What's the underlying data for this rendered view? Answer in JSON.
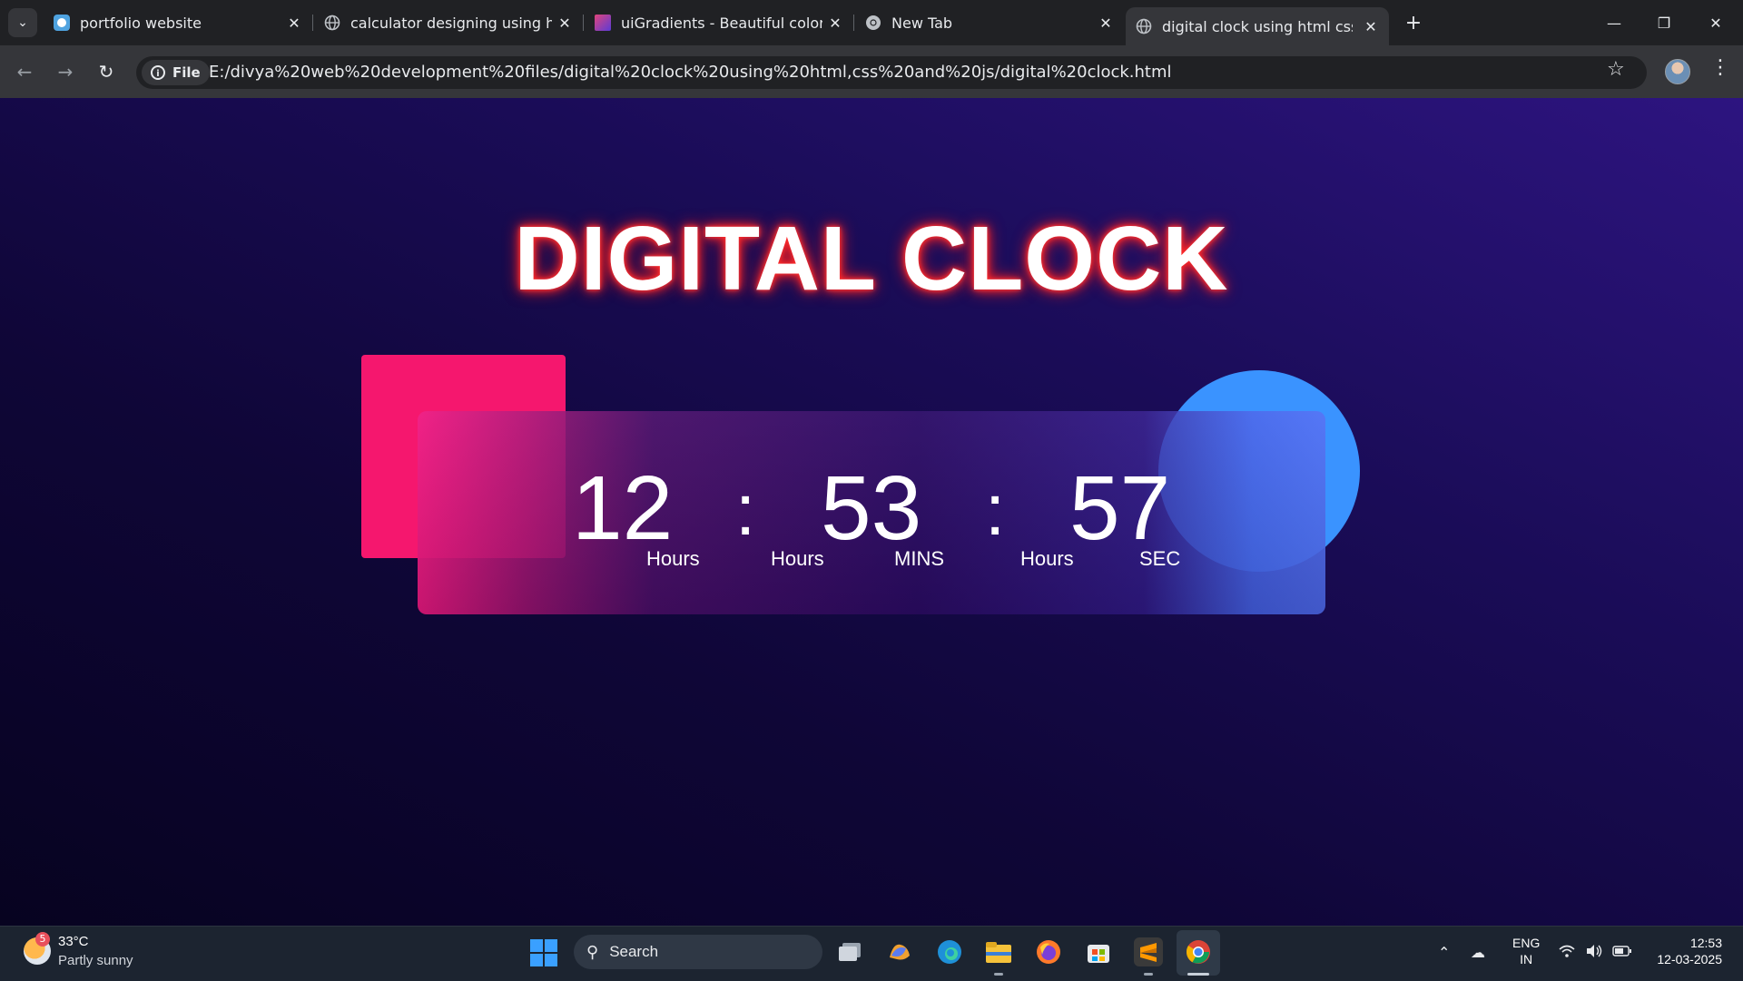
{
  "browser": {
    "tabs": [
      {
        "label": "portfolio website",
        "icon": "site-logo-icon"
      },
      {
        "label": "calculator designing using html",
        "icon": "globe-icon"
      },
      {
        "label": "uiGradients - Beautiful colored gradients",
        "icon": "uigradients-icon"
      },
      {
        "label": "New Tab",
        "icon": "chrome-icon"
      },
      {
        "label": "digital clock using html css and js",
        "icon": "globe-icon"
      }
    ],
    "active_tab_index": 4,
    "chip_label": "File",
    "url": "E:/divya%20web%20development%20files/digital%20clock%20using%20html,css%20and%20js/digital%20clock.html"
  },
  "page": {
    "title": "DIGITAL CLOCK",
    "clock": {
      "hours": "12",
      "minutes": "53",
      "seconds": "57",
      "separator": ":",
      "labels": [
        "Hours",
        "Hours",
        "MINS",
        "Hours",
        "SEC"
      ]
    }
  },
  "taskbar": {
    "weather_badge": "5",
    "temperature": "33°C",
    "weather_desc": "Partly sunny",
    "search_label": "Search",
    "lang_line1": "ENG",
    "lang_line2": "IN",
    "time": "12:53",
    "date": "12-03-2025"
  },
  "colors": {
    "accent_pink": "#f5176e",
    "accent_blue": "#3a93ff",
    "title_glow": "#ff1a1a"
  }
}
